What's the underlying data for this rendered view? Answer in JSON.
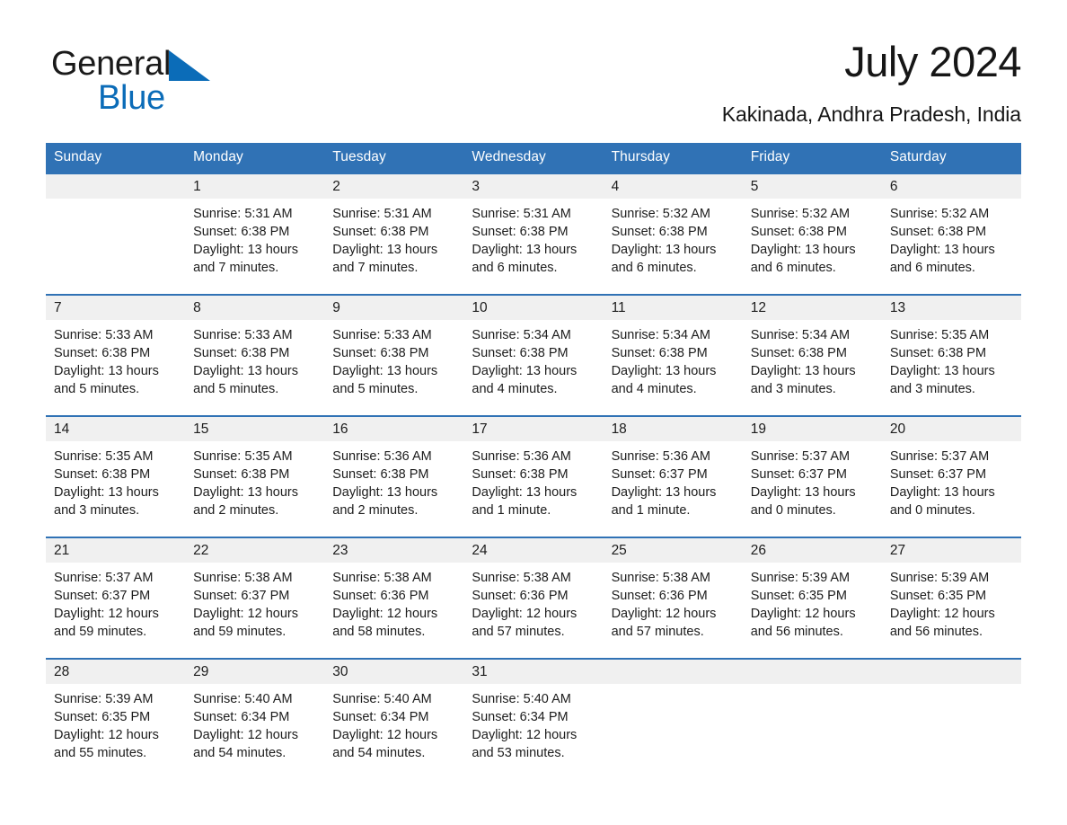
{
  "brand": {
    "name_part1": "General",
    "name_part2": "Blue",
    "triangle_icon": "triangle-icon",
    "accent_color": "#0b6cb8"
  },
  "header": {
    "month_title": "July 2024",
    "location": "Kakinada, Andhra Pradesh, India"
  },
  "theme": {
    "header_blue": "#3072b5",
    "daynum_gray": "#f0f0f0",
    "text_color": "#1c1c1c"
  },
  "calendar": {
    "weekday_headers": [
      "Sunday",
      "Monday",
      "Tuesday",
      "Wednesday",
      "Thursday",
      "Friday",
      "Saturday"
    ],
    "weeks": [
      [
        {
          "day": "",
          "sunrise": "",
          "sunset": "",
          "daylight": "",
          "empty": true
        },
        {
          "day": "1",
          "sunrise": "Sunrise: 5:31 AM",
          "sunset": "Sunset: 6:38 PM",
          "daylight": "Daylight: 13 hours and 7 minutes."
        },
        {
          "day": "2",
          "sunrise": "Sunrise: 5:31 AM",
          "sunset": "Sunset: 6:38 PM",
          "daylight": "Daylight: 13 hours and 7 minutes."
        },
        {
          "day": "3",
          "sunrise": "Sunrise: 5:31 AM",
          "sunset": "Sunset: 6:38 PM",
          "daylight": "Daylight: 13 hours and 6 minutes."
        },
        {
          "day": "4",
          "sunrise": "Sunrise: 5:32 AM",
          "sunset": "Sunset: 6:38 PM",
          "daylight": "Daylight: 13 hours and 6 minutes."
        },
        {
          "day": "5",
          "sunrise": "Sunrise: 5:32 AM",
          "sunset": "Sunset: 6:38 PM",
          "daylight": "Daylight: 13 hours and 6 minutes."
        },
        {
          "day": "6",
          "sunrise": "Sunrise: 5:32 AM",
          "sunset": "Sunset: 6:38 PM",
          "daylight": "Daylight: 13 hours and 6 minutes."
        }
      ],
      [
        {
          "day": "7",
          "sunrise": "Sunrise: 5:33 AM",
          "sunset": "Sunset: 6:38 PM",
          "daylight": "Daylight: 13 hours and 5 minutes."
        },
        {
          "day": "8",
          "sunrise": "Sunrise: 5:33 AM",
          "sunset": "Sunset: 6:38 PM",
          "daylight": "Daylight: 13 hours and 5 minutes."
        },
        {
          "day": "9",
          "sunrise": "Sunrise: 5:33 AM",
          "sunset": "Sunset: 6:38 PM",
          "daylight": "Daylight: 13 hours and 5 minutes."
        },
        {
          "day": "10",
          "sunrise": "Sunrise: 5:34 AM",
          "sunset": "Sunset: 6:38 PM",
          "daylight": "Daylight: 13 hours and 4 minutes."
        },
        {
          "day": "11",
          "sunrise": "Sunrise: 5:34 AM",
          "sunset": "Sunset: 6:38 PM",
          "daylight": "Daylight: 13 hours and 4 minutes."
        },
        {
          "day": "12",
          "sunrise": "Sunrise: 5:34 AM",
          "sunset": "Sunset: 6:38 PM",
          "daylight": "Daylight: 13 hours and 3 minutes."
        },
        {
          "day": "13",
          "sunrise": "Sunrise: 5:35 AM",
          "sunset": "Sunset: 6:38 PM",
          "daylight": "Daylight: 13 hours and 3 minutes."
        }
      ],
      [
        {
          "day": "14",
          "sunrise": "Sunrise: 5:35 AM",
          "sunset": "Sunset: 6:38 PM",
          "daylight": "Daylight: 13 hours and 3 minutes."
        },
        {
          "day": "15",
          "sunrise": "Sunrise: 5:35 AM",
          "sunset": "Sunset: 6:38 PM",
          "daylight": "Daylight: 13 hours and 2 minutes."
        },
        {
          "day": "16",
          "sunrise": "Sunrise: 5:36 AM",
          "sunset": "Sunset: 6:38 PM",
          "daylight": "Daylight: 13 hours and 2 minutes."
        },
        {
          "day": "17",
          "sunrise": "Sunrise: 5:36 AM",
          "sunset": "Sunset: 6:38 PM",
          "daylight": "Daylight: 13 hours and 1 minute."
        },
        {
          "day": "18",
          "sunrise": "Sunrise: 5:36 AM",
          "sunset": "Sunset: 6:37 PM",
          "daylight": "Daylight: 13 hours and 1 minute."
        },
        {
          "day": "19",
          "sunrise": "Sunrise: 5:37 AM",
          "sunset": "Sunset: 6:37 PM",
          "daylight": "Daylight: 13 hours and 0 minutes."
        },
        {
          "day": "20",
          "sunrise": "Sunrise: 5:37 AM",
          "sunset": "Sunset: 6:37 PM",
          "daylight": "Daylight: 13 hours and 0 minutes."
        }
      ],
      [
        {
          "day": "21",
          "sunrise": "Sunrise: 5:37 AM",
          "sunset": "Sunset: 6:37 PM",
          "daylight": "Daylight: 12 hours and 59 minutes."
        },
        {
          "day": "22",
          "sunrise": "Sunrise: 5:38 AM",
          "sunset": "Sunset: 6:37 PM",
          "daylight": "Daylight: 12 hours and 59 minutes."
        },
        {
          "day": "23",
          "sunrise": "Sunrise: 5:38 AM",
          "sunset": "Sunset: 6:36 PM",
          "daylight": "Daylight: 12 hours and 58 minutes."
        },
        {
          "day": "24",
          "sunrise": "Sunrise: 5:38 AM",
          "sunset": "Sunset: 6:36 PM",
          "daylight": "Daylight: 12 hours and 57 minutes."
        },
        {
          "day": "25",
          "sunrise": "Sunrise: 5:38 AM",
          "sunset": "Sunset: 6:36 PM",
          "daylight": "Daylight: 12 hours and 57 minutes."
        },
        {
          "day": "26",
          "sunrise": "Sunrise: 5:39 AM",
          "sunset": "Sunset: 6:35 PM",
          "daylight": "Daylight: 12 hours and 56 minutes."
        },
        {
          "day": "27",
          "sunrise": "Sunrise: 5:39 AM",
          "sunset": "Sunset: 6:35 PM",
          "daylight": "Daylight: 12 hours and 56 minutes."
        }
      ],
      [
        {
          "day": "28",
          "sunrise": "Sunrise: 5:39 AM",
          "sunset": "Sunset: 6:35 PM",
          "daylight": "Daylight: 12 hours and 55 minutes."
        },
        {
          "day": "29",
          "sunrise": "Sunrise: 5:40 AM",
          "sunset": "Sunset: 6:34 PM",
          "daylight": "Daylight: 12 hours and 54 minutes."
        },
        {
          "day": "30",
          "sunrise": "Sunrise: 5:40 AM",
          "sunset": "Sunset: 6:34 PM",
          "daylight": "Daylight: 12 hours and 54 minutes."
        },
        {
          "day": "31",
          "sunrise": "Sunrise: 5:40 AM",
          "sunset": "Sunset: 6:34 PM",
          "daylight": "Daylight: 12 hours and 53 minutes."
        },
        {
          "day": "",
          "sunrise": "",
          "sunset": "",
          "daylight": "",
          "empty": true
        },
        {
          "day": "",
          "sunrise": "",
          "sunset": "",
          "daylight": "",
          "empty": true
        },
        {
          "day": "",
          "sunrise": "",
          "sunset": "",
          "daylight": "",
          "empty": true
        }
      ]
    ]
  }
}
